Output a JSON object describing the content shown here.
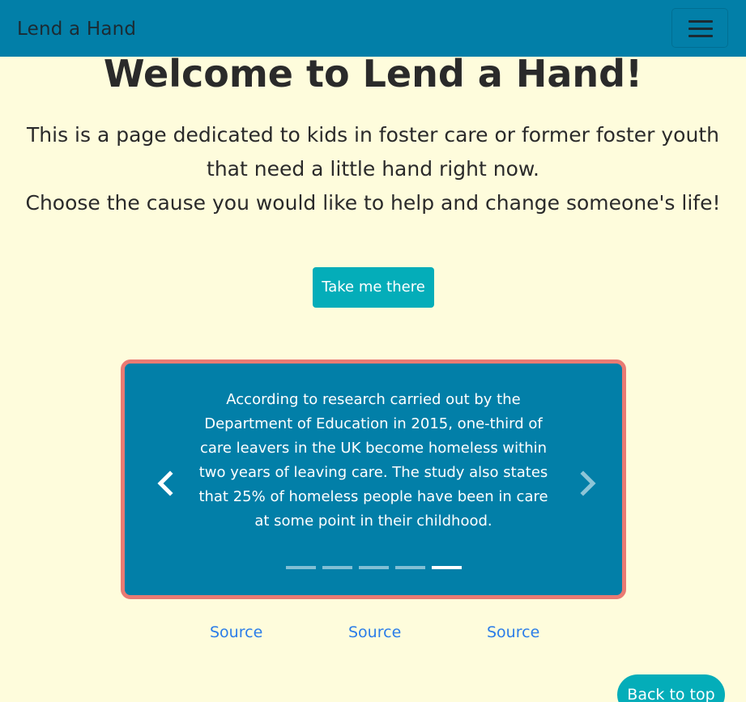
{
  "navbar": {
    "brand": "Lend a Hand",
    "toggler_icon": "hamburger-icon"
  },
  "hero": {
    "title": "Welcome to Lend a Hand!",
    "intro_line1": "This is a page dedicated to kids in foster care or former foster youth that need a little hand right now.",
    "intro_line2": "Choose the cause you would like to help and change someone's life!",
    "cta_label": "Take me there"
  },
  "carousel": {
    "slide_text": "According to research carried out by the Department of Education in 2015, one-third of care leavers in the UK become homeless within two years of leaving care. The study also states that 25% of homeless people have been in care at some point in their childhood.",
    "prev_icon": "chevron-left-icon",
    "next_icon": "chevron-right-icon",
    "indicator_count": 5,
    "active_indicator": 5,
    "border_color": "#e97a73",
    "background_color": "#027fa8"
  },
  "sources": [
    "Source",
    "Source",
    "Source"
  ],
  "footer": {
    "back_to_top": "Back to top"
  },
  "colors": {
    "page_background": "#fefcdc",
    "navbar": "#027fa8",
    "button": "#04adb9",
    "link": "#2b7de8"
  }
}
